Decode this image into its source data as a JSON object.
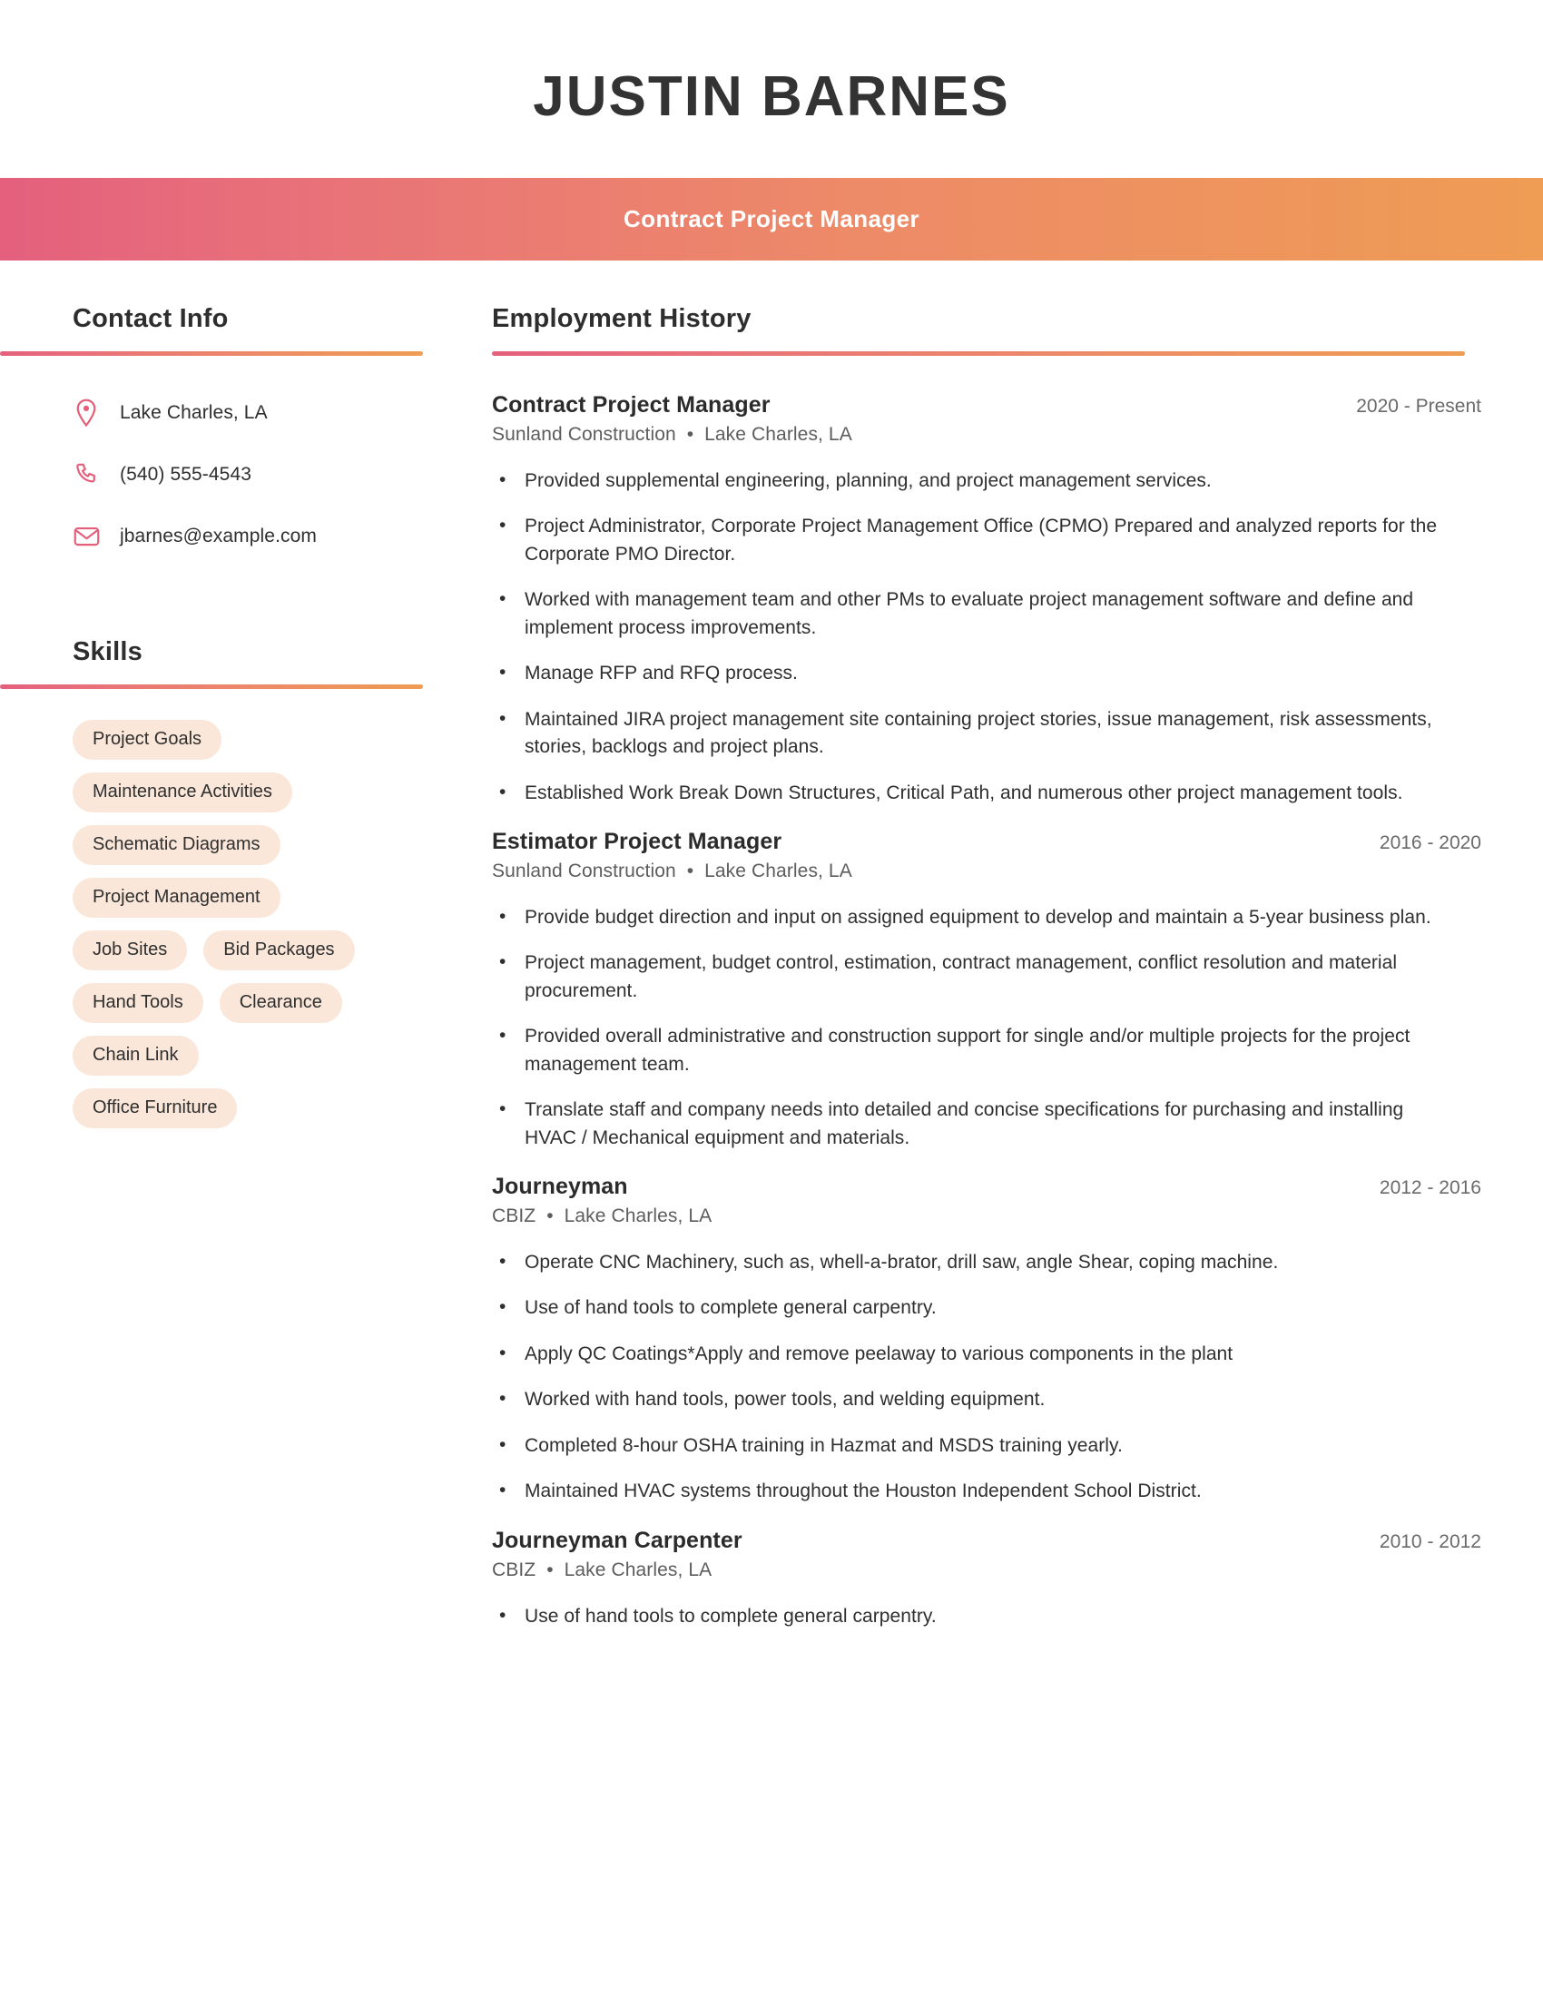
{
  "header": {
    "name": "JUSTIN BARNES",
    "title": "Contract Project Manager",
    "gradient_start": "#e4607d",
    "gradient_end": "#ef9c54",
    "name_color": "#333333"
  },
  "sidebar": {
    "contact": {
      "heading": "Contact Info",
      "items": [
        {
          "icon": "location-pin-icon",
          "text": "Lake Charles, LA"
        },
        {
          "icon": "phone-icon",
          "text": "(540) 555-4543"
        },
        {
          "icon": "email-envelope-icon",
          "text": "jbarnes@example.com"
        }
      ]
    },
    "skills": {
      "heading": "Skills",
      "pill_color": "#fae7d9",
      "items": [
        "Project Goals",
        "Maintenance Activities",
        "Schematic Diagrams",
        "Project Management",
        "Job Sites",
        "Bid Packages",
        "Hand Tools",
        "Clearance",
        "Chain Link",
        "Office Furniture"
      ]
    }
  },
  "main": {
    "employment": {
      "heading": "Employment History",
      "jobs": [
        {
          "title": "Contract Project Manager",
          "dates": "2020 - Present",
          "company": "Sunland Construction",
          "location": "Lake Charles, LA",
          "bullets": [
            "Provided supplemental engineering, planning, and project management services.",
            "Project Administrator, Corporate Project Management Office (CPMO) Prepared and analyzed reports for the Corporate PMO Director.",
            "Worked with management team and other PMs to evaluate project management software and define and implement process improvements.",
            "Manage RFP and RFQ process.",
            "Maintained JIRA project management site containing project stories, issue management, risk assessments, stories, backlogs and project plans.",
            "Established Work Break Down Structures, Critical Path, and numerous other project management tools."
          ]
        },
        {
          "title": "Estimator Project Manager",
          "dates": "2016 - 2020",
          "company": "Sunland Construction",
          "location": "Lake Charles, LA",
          "bullets": [
            "Provide budget direction and input on assigned equipment to develop and maintain a 5-year business plan.",
            "Project management, budget control, estimation, contract management, conflict resolution and material procurement.",
            "Provided overall administrative and construction support for single and/or multiple projects for the project management team.",
            "Translate staff and company needs into detailed and concise specifications for purchasing and installing HVAC / Mechanical equipment and materials."
          ]
        },
        {
          "title": "Journeyman",
          "dates": "2012 - 2016",
          "company": "CBIZ",
          "location": "Lake Charles, LA",
          "bullets": [
            "Operate CNC Machinery, such as, whell-a-brator, drill saw, angle Shear, coping machine.",
            "Use of hand tools to complete general carpentry.",
            "Apply QC Coatings*Apply and remove peelaway to various components in the plant",
            "Worked with hand tools, power tools, and welding equipment.",
            "Completed 8-hour OSHA training in Hazmat and MSDS training yearly.",
            "Maintained HVAC systems throughout the Houston Independent School District."
          ]
        },
        {
          "title": "Journeyman Carpenter",
          "dates": "2010 - 2012",
          "company": "CBIZ",
          "location": "Lake Charles, LA",
          "bullets": [
            "Use of hand tools to complete general carpentry."
          ]
        }
      ]
    }
  },
  "separator_bullet": "•"
}
